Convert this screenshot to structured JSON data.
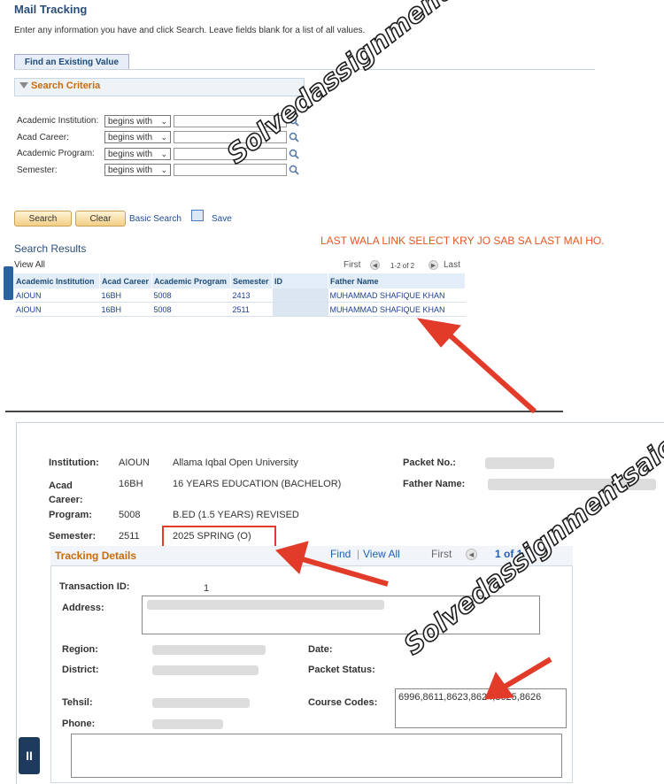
{
  "search_page": {
    "title": "Mail Tracking",
    "instructions": "Enter any information you have and click Search. Leave fields blank for a list of all values.",
    "tab_label": "Find an Existing Value",
    "criteria_label": "Search Criteria",
    "fields": [
      {
        "label": "Academic Institution:",
        "operator": "begins with"
      },
      {
        "label": "Acad Career:",
        "operator": "begins with"
      },
      {
        "label": "Academic Program:",
        "operator": "begins with"
      },
      {
        "label": "Semester:",
        "operator": "begins with"
      }
    ],
    "search_button": "Search",
    "clear_button": "Clear",
    "basic_search_link": "Basic Search",
    "save_search_link": "Save",
    "results_title": "Search Results",
    "view_all": "View All",
    "nav_first": "First",
    "nav_count": "1-2 of 2",
    "nav_last": "Last",
    "columns": [
      "Academic Institution",
      "Acad Career",
      "Academic Program",
      "Semester",
      "ID",
      "Father Name"
    ],
    "rows": [
      {
        "institution": "AIOUN",
        "career": "16BH",
        "program": "5008",
        "semester": "2413",
        "father": "MUHAMMAD SHAFIQUE KHAN"
      },
      {
        "institution": "AIOUN",
        "career": "16BH",
        "program": "5008",
        "semester": "2511",
        "father": "MUHAMMAD SHAFIQUE KHAN"
      }
    ]
  },
  "annotation_text": "LAST WALA LINK SELECT KRY JO SAB SA LAST MAI HO.",
  "watermark": "Solvedassignmentsaiou.com",
  "detail_page": {
    "institution_label": "Institution:",
    "institution_code": "AIOUN",
    "institution_name": "Allama Iqbal Open University",
    "packet_no_label": "Packet No.:",
    "career_label": "Acad Career:",
    "career_code": "16BH",
    "career_name": "16 YEARS EDUCATION (BACHELOR)",
    "father_label": "Father Name:",
    "program_label": "Program:",
    "program_code": "5008",
    "program_name": "B.ED (1.5 YEARS) REVISED",
    "semester_label": "Semester:",
    "semester_code": "2511",
    "semester_name": "2025 SPRING (O)",
    "tracking_title": "Tracking Details",
    "find_link": "Find",
    "view_all_link": "View All",
    "first_label": "First",
    "page_count": "1 of 1",
    "transaction_label": "Transaction ID:",
    "transaction_value": "1",
    "address_label": "Address:",
    "region_label": "Region:",
    "date_label": "Date:",
    "district_label": "District:",
    "packet_status_label": "Packet Status:",
    "tehsil_label": "Tehsil:",
    "course_codes_label": "Course Codes:",
    "course_codes_value": "6996,8611,8623,8624,8625,8626",
    "phone_label": "Phone:"
  },
  "colors": {
    "accent_orange": "#c86b0a",
    "link_blue": "#2260b4",
    "annotation_red": "#e23b2a"
  }
}
